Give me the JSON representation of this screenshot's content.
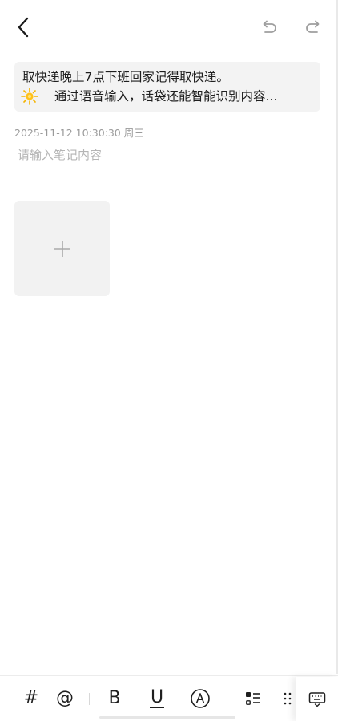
{
  "header": {
    "back_icon": "chevron-left-icon",
    "undo_icon": "undo-icon",
    "redo_icon": "redo-icon"
  },
  "tip": {
    "line1": "取快递晚上7点下班回家记得取快递。",
    "icon": "sparkle-icon",
    "line2": "通过语音输入，话袋还能智能识别内容..."
  },
  "note": {
    "timestamp": "2025-11-12 10:30:30 周三",
    "value": "",
    "placeholder": "请输入笔记内容"
  },
  "attachment": {
    "add_icon": "plus-icon"
  },
  "toolbar": {
    "hashtag_label": "#",
    "mention_label": "@",
    "bold_label": "B",
    "underline_label": "U",
    "items": [
      "hashtag",
      "mention",
      "bold",
      "underline",
      "highlight",
      "checklist",
      "list",
      "keyboard"
    ]
  },
  "colors": {
    "tip_background": "#f3f3f3",
    "placeholder": "#b5b5b5",
    "timestamp": "#9a9a9a",
    "add_tile_background": "#f2f2f2"
  }
}
